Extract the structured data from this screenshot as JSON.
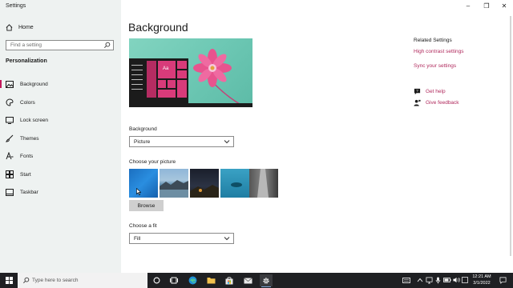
{
  "window": {
    "title": "Settings"
  },
  "sidebar": {
    "home_label": "Home",
    "search_placeholder": "Find a setting",
    "section": "Personalization",
    "items": [
      {
        "label": "Background",
        "icon": "image-icon",
        "selected": true
      },
      {
        "label": "Colors",
        "icon": "palette-icon",
        "selected": false
      },
      {
        "label": "Lock screen",
        "icon": "lock-screen-icon",
        "selected": false
      },
      {
        "label": "Themes",
        "icon": "brush-icon",
        "selected": false
      },
      {
        "label": "Fonts",
        "icon": "font-icon",
        "selected": false
      },
      {
        "label": "Start",
        "icon": "start-icon",
        "selected": false
      },
      {
        "label": "Taskbar",
        "icon": "taskbar-icon",
        "selected": false
      }
    ]
  },
  "main": {
    "title": "Background",
    "background_label": "Background",
    "background_value": "Picture",
    "choose_picture_label": "Choose your picture",
    "browse_label": "Browse",
    "choose_fit_label": "Choose a fit",
    "fit_value": "Fill"
  },
  "related": {
    "title": "Related Settings",
    "links": [
      "High contrast settings",
      "Sync your settings"
    ],
    "help": "Get help",
    "feedback": "Give feedback"
  },
  "taskbar": {
    "search_placeholder": "Type here to search",
    "time": "12:21 AM",
    "date": "3/1/2022"
  },
  "colors": {
    "accent": "#b02a5d",
    "sidebar_bg": "#eef2f1",
    "taskbar_bg": "#1f2023",
    "preview_bg": "#6cc7b3",
    "tile": "#d83b7a"
  }
}
